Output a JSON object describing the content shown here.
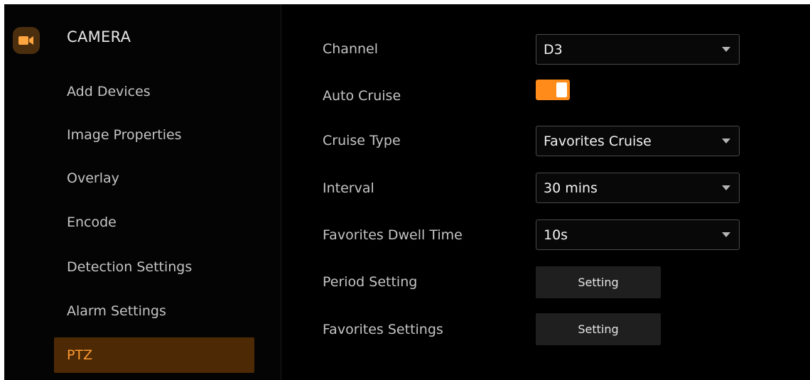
{
  "sidebar": {
    "title": "CAMERA",
    "items": [
      {
        "label": "Add Devices"
      },
      {
        "label": "Image Properties"
      },
      {
        "label": "Overlay"
      },
      {
        "label": "Encode"
      },
      {
        "label": "Detection Settings"
      },
      {
        "label": "Alarm Settings"
      },
      {
        "label": "PTZ",
        "active": true
      }
    ]
  },
  "form": {
    "channel": {
      "label": "Channel",
      "value": "D3"
    },
    "auto_cruise": {
      "label": "Auto Cruise",
      "enabled": true
    },
    "cruise_type": {
      "label": "Cruise Type",
      "value": "Favorites Cruise"
    },
    "interval": {
      "label": "Interval",
      "value": "30 mins"
    },
    "dwell_time": {
      "label": "Favorites Dwell Time",
      "value": "10s"
    },
    "period_setting": {
      "label": "Period Setting",
      "button": "Setting"
    },
    "favorites_settings": {
      "label": "Favorites Settings",
      "button": "Setting"
    }
  },
  "colors": {
    "accent": "#ff8c1a",
    "active_bg": "#4d2a05",
    "background": "#000000"
  },
  "icons": {
    "camera": "video-camera-icon",
    "dropdown": "triangle-down-icon"
  }
}
